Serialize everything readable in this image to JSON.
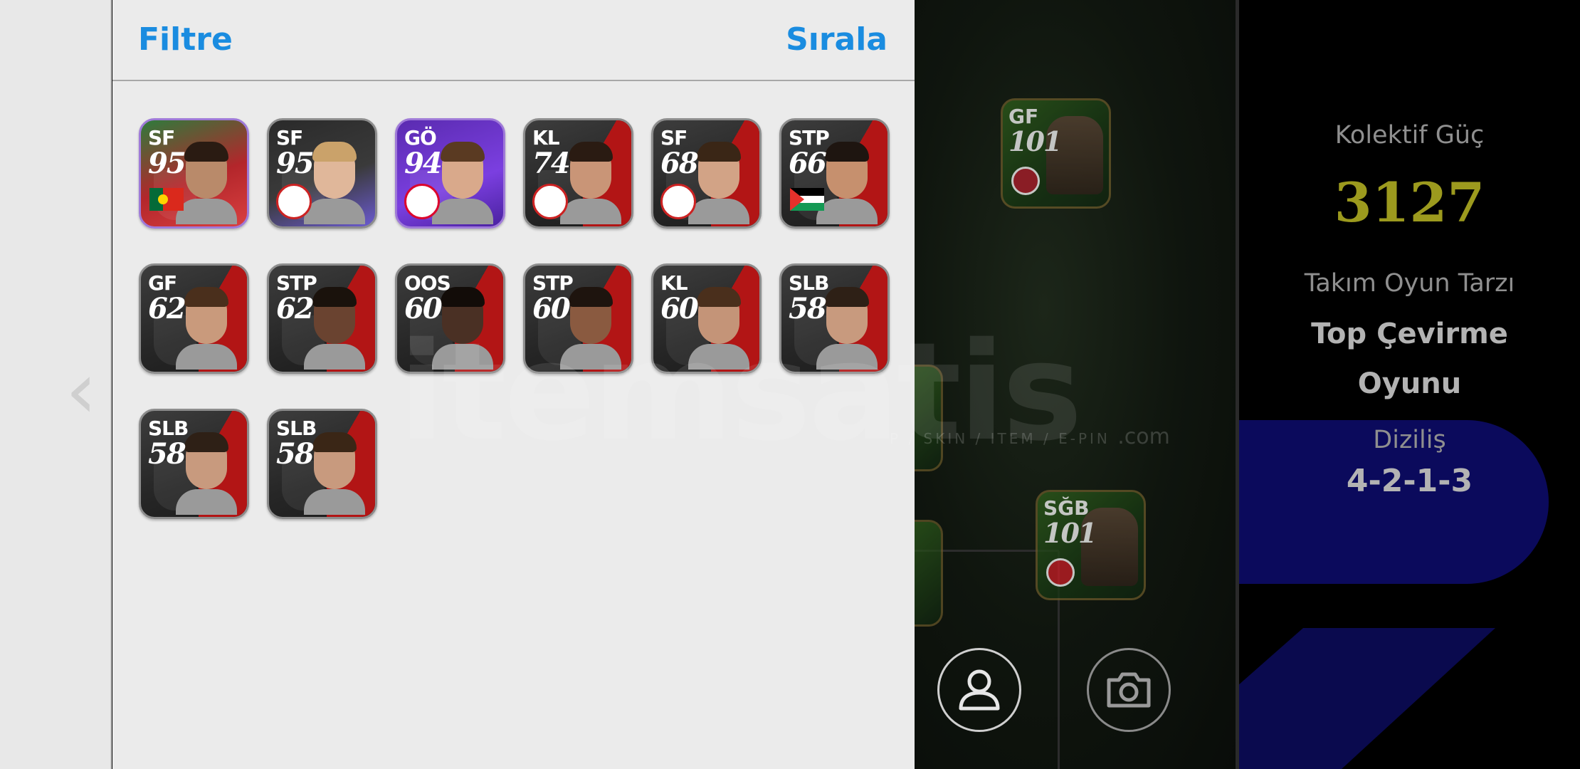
{
  "header": {
    "filter_label": "Filtre",
    "sort_label": "Sırala"
  },
  "players": [
    {
      "pos": "SF",
      "rating": "95",
      "flag": "portugal",
      "special": true,
      "skin": "#b98a6a",
      "hair": "#2a1b12"
    },
    {
      "pos": "SF",
      "rating": "95",
      "flag": "club-badge",
      "special": false,
      "skin": "#e0b79a",
      "hair": "#caa26a"
    },
    {
      "pos": "GÖ",
      "rating": "94",
      "flag": "bayern-badge",
      "special": true,
      "skin": "#d9a98b",
      "hair": "#5a3a22"
    },
    {
      "pos": "KL",
      "rating": "74",
      "flag": "club-badge",
      "special": false,
      "skin": "#c99577",
      "hair": "#2a1b12"
    },
    {
      "pos": "SF",
      "rating": "68",
      "flag": "club-badge",
      "special": false,
      "skin": "#d2a386",
      "hair": "#3a2616"
    },
    {
      "pos": "STP",
      "rating": "66",
      "flag": "palestine",
      "special": false,
      "skin": "#c6906e",
      "hair": "#1e1510"
    },
    {
      "pos": "GF",
      "rating": "62",
      "flag": "",
      "special": false,
      "skin": "#c99a7c",
      "hair": "#4a2f1c"
    },
    {
      "pos": "STP",
      "rating": "62",
      "flag": "",
      "special": false,
      "skin": "#6a4330",
      "hair": "#1a120c"
    },
    {
      "pos": "OOS",
      "rating": "60",
      "flag": "",
      "special": false,
      "skin": "#4a3024",
      "hair": "#120c08"
    },
    {
      "pos": "STP",
      "rating": "60",
      "flag": "",
      "special": false,
      "skin": "#8a5a40",
      "hair": "#1e140e"
    },
    {
      "pos": "KL",
      "rating": "60",
      "flag": "",
      "special": false,
      "skin": "#c49478",
      "hair": "#4a2f1c"
    },
    {
      "pos": "SLB",
      "rating": "58",
      "flag": "",
      "special": false,
      "skin": "#c89a7e",
      "hair": "#2e2016"
    },
    {
      "pos": "SLB",
      "rating": "58",
      "flag": "",
      "special": false,
      "skin": "#c89a7e",
      "hair": "#2e2016"
    },
    {
      "pos": "SLB",
      "rating": "58",
      "flag": "",
      "special": false,
      "skin": "#c89a7e",
      "hair": "#3a2616"
    }
  ],
  "pitch": {
    "top_card": {
      "pos": "GF",
      "rating": "101"
    },
    "bottom_card": {
      "pos": "SĞB",
      "rating": "101"
    }
  },
  "info": {
    "power_label": "Kolektif Güç",
    "power_value": "3127",
    "style_label": "Takım Oyun Tarzı",
    "style_value_line1": "Top Çevirme",
    "style_value_line2": "Oyunu",
    "formation_label": "Diziliş",
    "formation_value": "4-2-1-3"
  },
  "watermark": {
    "text": "itemsatis",
    "sub": "P / SKIN / ITEM / E-PIN",
    "suffix": ".com"
  },
  "colors": {
    "accent": "#1a8ce0",
    "power": "#9c9a1e",
    "panel_bg": "#ebebeb",
    "pitch_bg": "#0f150e"
  }
}
